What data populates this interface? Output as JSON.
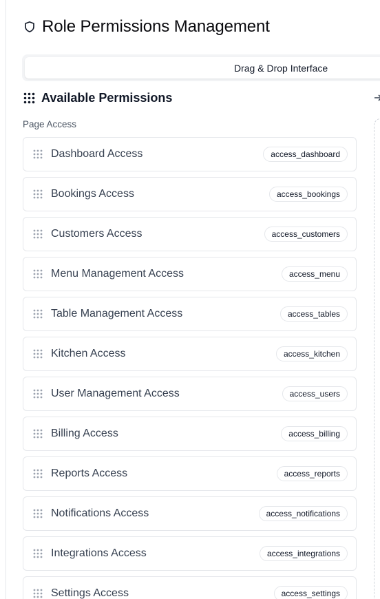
{
  "header": {
    "title": "Role Permissions Management",
    "icon": "shield-icon"
  },
  "tabs": {
    "active_label": "Drag & Drop Interface"
  },
  "available": {
    "title": "Available Permissions",
    "icon": "grip-icon",
    "group_label": "Page Access",
    "items": [
      {
        "label": "Dashboard Access",
        "key": "access_dashboard"
      },
      {
        "label": "Bookings Access",
        "key": "access_bookings"
      },
      {
        "label": "Customers Access",
        "key": "access_customers"
      },
      {
        "label": "Menu Management Access",
        "key": "access_menu"
      },
      {
        "label": "Table Management Access",
        "key": "access_tables"
      },
      {
        "label": "Kitchen Access",
        "key": "access_kitchen"
      },
      {
        "label": "User Management Access",
        "key": "access_users"
      },
      {
        "label": "Billing Access",
        "key": "access_billing"
      },
      {
        "label": "Reports Access",
        "key": "access_reports"
      },
      {
        "label": "Notifications Access",
        "key": "access_notifications"
      },
      {
        "label": "Integrations Access",
        "key": "access_integrations"
      },
      {
        "label": "Settings Access",
        "key": "access_settings"
      }
    ]
  },
  "colors": {
    "border": "#e5e7eb",
    "text": "#374151",
    "tab_bg": "#f3f4f6"
  }
}
